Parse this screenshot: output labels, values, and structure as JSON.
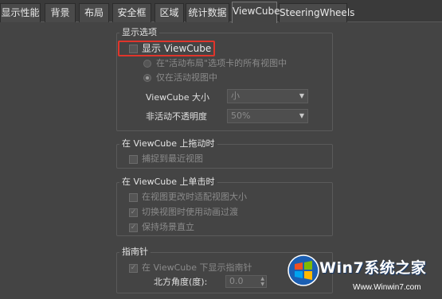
{
  "tabs": [
    {
      "label": "显示性能",
      "active": false
    },
    {
      "label": "背景",
      "active": false
    },
    {
      "label": "布局",
      "active": false
    },
    {
      "label": "安全框",
      "active": false
    },
    {
      "label": "区域",
      "active": false
    },
    {
      "label": "统计数据",
      "active": false
    },
    {
      "label": "ViewCube",
      "active": true
    },
    {
      "label": "SteeringWheels",
      "active": false
    }
  ],
  "display_options": {
    "title": "显示选项",
    "show_viewcube": {
      "label": "显示 ViewCube",
      "checked": false
    },
    "radio_all_views": {
      "label": "在\"活动布局\"选项卡的所有视图中",
      "selected": false
    },
    "radio_active_only": {
      "label": "仅在活动视图中",
      "selected": true
    },
    "size": {
      "label": "ViewCube 大小",
      "value": "小"
    },
    "opacity": {
      "label": "非活动不透明度",
      "value": "50%"
    }
  },
  "drag_group": {
    "title": "在 ViewCube 上拖动时",
    "snap": {
      "label": "捕捉到最近视图",
      "checked": false
    }
  },
  "click_group": {
    "title": "在 ViewCube 上单击时",
    "fit_view": {
      "label": "在视图更改时适配视图大小",
      "checked": false
    },
    "animate": {
      "label": "切换视图时使用动画过渡",
      "checked": true
    },
    "keep_upright": {
      "label": "保持场景直立",
      "checked": true
    }
  },
  "compass_group": {
    "title": "指南针",
    "show_compass": {
      "label": "在 ViewCube 下显示指南针",
      "checked": true
    },
    "north_angle": {
      "label": "北方角度(度):",
      "value": "0.0"
    }
  },
  "watermark": {
    "title": "Win7系统之家",
    "url": "Www.Winwin7.com"
  },
  "colors": {
    "background": "#444444",
    "highlight": "#e0352b"
  }
}
